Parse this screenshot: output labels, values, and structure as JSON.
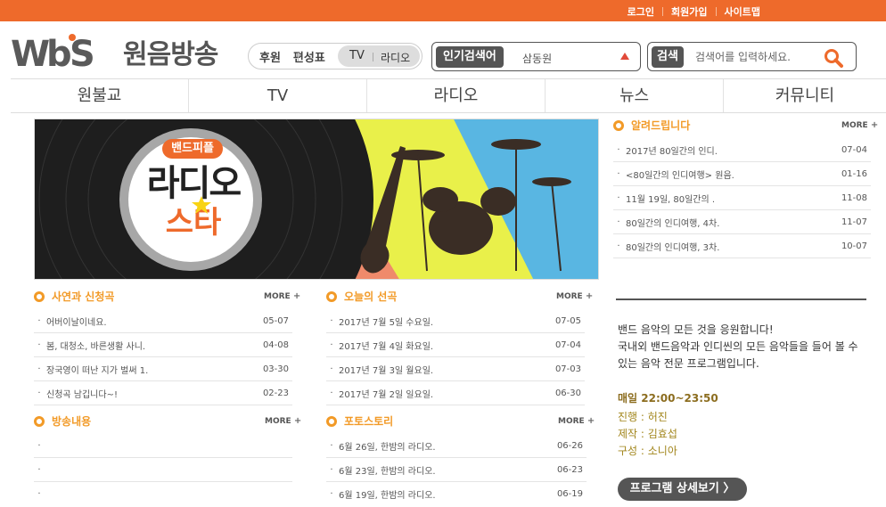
{
  "top_links": [
    "로그인",
    "회원가입",
    "사이트맵"
  ],
  "logo": {
    "brand": "WBS",
    "name": "원음방송"
  },
  "subnav": {
    "donate": "후원",
    "schedule": "편성표",
    "tv": "TV",
    "radio": "라디오"
  },
  "popular_search": {
    "label": "인기검색어",
    "value": "삼동원"
  },
  "search": {
    "label": "검색",
    "placeholder": "검색어를 입력하세요."
  },
  "main_nav": [
    "원불교",
    "TV",
    "라디오",
    "뉴스",
    "커뮤니티"
  ],
  "banner": {
    "badge": "밴드피플",
    "title_line1": "라디오",
    "title_line2": "스타"
  },
  "sections": {
    "story": {
      "title": "사연과 신청곡",
      "more": "MORE",
      "items": [
        {
          "title": "어버이날이네요.",
          "date": "05-07"
        },
        {
          "title": "봄, 대청소, 바른생활 사니.",
          "date": "04-08"
        },
        {
          "title": "장국영이 떠난 지가 벌써 1.",
          "date": "03-30"
        },
        {
          "title": "신청곡 남깁니다~!",
          "date": "02-23"
        }
      ]
    },
    "picks": {
      "title": "오늘의 선곡",
      "more": "MORE",
      "items": [
        {
          "title": "2017년 7월 5일 수요일.",
          "date": "07-05"
        },
        {
          "title": "2017년 7월 4일 화요일.",
          "date": "07-04"
        },
        {
          "title": "2017년 7월 3일 월요일.",
          "date": "07-03"
        },
        {
          "title": "2017년 7월 2일 일요일.",
          "date": "06-30"
        }
      ]
    },
    "broadcast": {
      "title": "방송내용",
      "more": "MORE",
      "items": [
        {
          "title": "",
          "date": ""
        },
        {
          "title": "",
          "date": ""
        },
        {
          "title": "",
          "date": ""
        }
      ]
    },
    "photo": {
      "title": "포토스토리",
      "more": "MORE",
      "items": [
        {
          "title": "6월 26일, 한밤의 라디오.",
          "date": "06-26"
        },
        {
          "title": "6월 23일, 한밤의 라디오.",
          "date": "06-23"
        },
        {
          "title": "6월 19일, 한밤의 라디오.",
          "date": "06-19"
        }
      ]
    },
    "notice": {
      "title": "알려드립니다",
      "more": "MORE",
      "items": [
        {
          "title": "2017년 80일간의 인디.",
          "date": "07-04"
        },
        {
          "title": "<80일간의 인디여행> 원음.",
          "date": "01-16"
        },
        {
          "title": "11월 19일, 80일간의 .",
          "date": "11-08"
        },
        {
          "title": "80일간의 인디여행, 4차.",
          "date": "11-07"
        },
        {
          "title": "80일간의 인디여행, 3차.",
          "date": "10-07"
        }
      ]
    }
  },
  "program": {
    "description_line1": "밴드 음악의 모든 것을 응원합니다!",
    "description_line2": "국내외 밴드음악과 인디씬의 모든 음악들을 들어 볼 수 있는 음악 전문 프로그램입니다.",
    "schedule": "매일 22:00~23:50",
    "host": "진행 : 허진",
    "producer": "제작 : 김효섭",
    "writer": "구성 : 소니아",
    "detail_button": "프로그램 상세보기 〉"
  },
  "colors": {
    "accent": "#ee6a2b",
    "section_title": "#f29a27",
    "dark": "#555555"
  }
}
